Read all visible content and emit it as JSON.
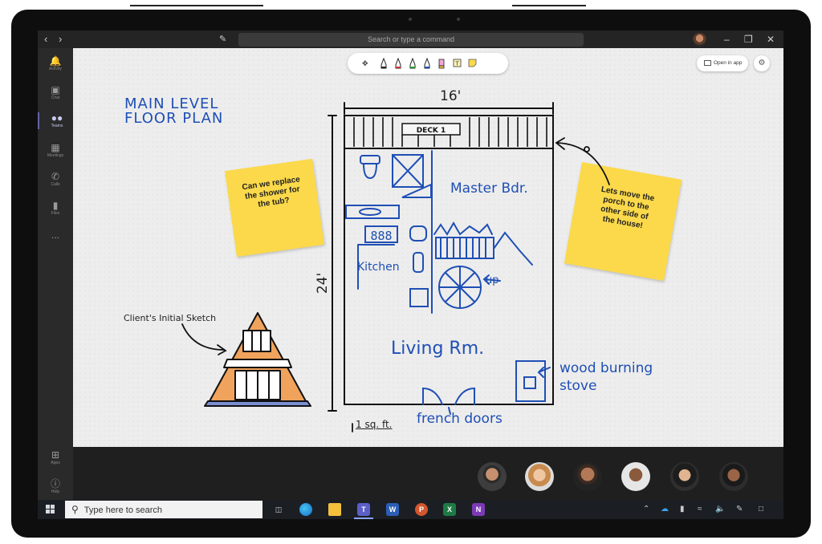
{
  "window": {
    "search_placeholder": "Search or type a command",
    "nav_back_icon": "chevron-left-icon",
    "nav_forward_icon": "chevron-right-icon",
    "compose_icon": "compose-icon"
  },
  "rail": {
    "items": [
      {
        "label": "Activity",
        "icon": "bell-icon"
      },
      {
        "label": "Chat",
        "icon": "chat-icon"
      },
      {
        "label": "Teams",
        "icon": "teams-icon",
        "active": true
      },
      {
        "label": "Meetings",
        "icon": "calendar-icon"
      },
      {
        "label": "Calls",
        "icon": "phone-icon"
      },
      {
        "label": "Files",
        "icon": "file-icon"
      }
    ],
    "more": "...",
    "bottom": [
      {
        "label": "Apps",
        "icon": "apps-icon"
      },
      {
        "label": "Help",
        "icon": "help-icon"
      }
    ]
  },
  "whiteboard": {
    "open_in_app": "Open in app",
    "title": "MAIN LEVEL\nFLOOR PLAN",
    "width_label": "16'",
    "height_label": "24'",
    "deck_label": "DECK 1",
    "room_master": "Master Bdr.",
    "room_kitchen": "Kitchen",
    "room_living": "Living Rm.",
    "stairs_label": "up",
    "stove_label": "wood burning\nstove",
    "doors_label": "french doors",
    "scale_label": "1 sq. ft.",
    "sketch_label": "Client's Initial Sketch",
    "sticky_left": [
      "Can we replace",
      "the shower for",
      "the tub?"
    ],
    "sticky_right": [
      "Lets move the",
      "porch to the",
      "other side of",
      "the house!"
    ]
  },
  "taskbar": {
    "search_placeholder": "Type here to search"
  },
  "colors": {
    "ink_blue": "#1f4fb5",
    "sticky_yellow": "#fbd94a",
    "teams_purple": "#6264a7",
    "board_bg": "#ededed"
  }
}
